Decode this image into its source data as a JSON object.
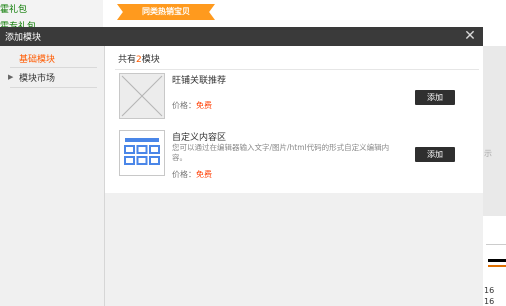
{
  "background": {
    "left_items": [
      "霍礼包",
      "霍专礼包"
    ],
    "tab_label": "同类热销宝贝",
    "side_text": "示",
    "right_numbers": [
      "16",
      "16"
    ]
  },
  "modal": {
    "title": "添加模块",
    "close_icon": "close-icon",
    "sidebar": {
      "items": [
        {
          "label": "基础模块",
          "active": true
        },
        {
          "label": "模块市场",
          "active": false,
          "icon": "triangle-right-icon"
        }
      ]
    },
    "content": {
      "header_prefix": "共有",
      "header_count": "2",
      "header_suffix": "模块",
      "modules": [
        {
          "name": "旺铺关联推荐",
          "icon": "placeholder-image-icon",
          "price_label": "价格：",
          "price_value": "免费",
          "button_label": "添加"
        },
        {
          "name": "自定义内容区",
          "icon": "grid-layout-icon",
          "description": "您可以通过在编辑器输入文字/图片/html代码的形式自定义编辑内容。",
          "price_label": "价格：",
          "price_value": "免费",
          "button_label": "添加"
        }
      ]
    }
  },
  "colors": {
    "accent": "#ff5a00",
    "free": "#ff3c00",
    "header_bg": "#3a3a3a",
    "button_bg": "#2f2f2f",
    "grid_icon": "#4a86e8"
  }
}
